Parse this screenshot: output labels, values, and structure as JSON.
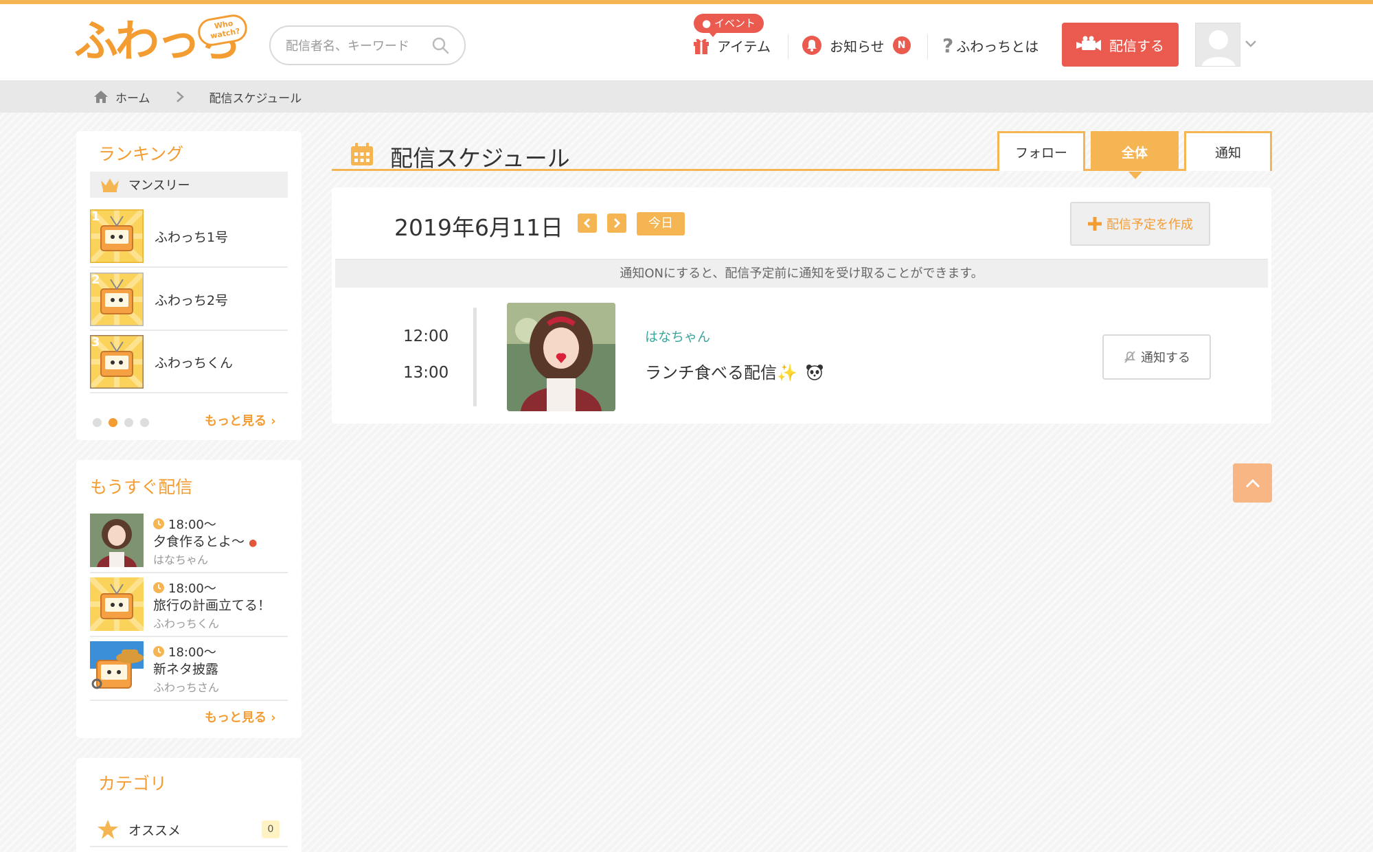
{
  "header": {
    "logo_text": "ふわっち",
    "logo_bubble": "Who watch?",
    "search_placeholder": "配信者名、キーワード",
    "event_label": "イベント",
    "nav": {
      "items_label": "アイテム",
      "news_label": "お知らせ",
      "news_badge": "N",
      "about_label": "ふわっちとは"
    },
    "broadcast_label": "配信する"
  },
  "breadcrumb": {
    "home": "ホーム",
    "current": "配信スケジュール"
  },
  "sidebar": {
    "ranking": {
      "title": "ランキング",
      "period": "マンスリー",
      "items": [
        {
          "rank": "1",
          "name": "ふわっち1号"
        },
        {
          "rank": "2",
          "name": "ふわっち2号"
        },
        {
          "rank": "3",
          "name": "ふわっちくん"
        }
      ],
      "more": "もっと見る"
    },
    "upcoming": {
      "title": "もうすぐ配信",
      "items": [
        {
          "time": "18:00〜",
          "title": "夕食作るとよ〜",
          "user": "はなちゃん"
        },
        {
          "time": "18:00〜",
          "title": "旅行の計画立てる！",
          "user": "ふわっちくん"
        },
        {
          "time": "18:00〜",
          "title": "新ネタ披露",
          "user": "ふわっちさん"
        }
      ],
      "more": "もっと見る"
    },
    "category": {
      "title": "カテゴリ",
      "items": [
        {
          "name": "オススメ",
          "count": "0"
        }
      ]
    }
  },
  "main": {
    "title": "配信スケジュール",
    "tabs": [
      "フォロー",
      "全体",
      "通知"
    ],
    "active_tab": "全体",
    "date": "2019年6月11日",
    "today_label": "今日",
    "create_label": "配信予定を作成",
    "notice": "通知ONにすると、配信予定前に通知を受け取ることができます。",
    "schedule": [
      {
        "start": "12:00",
        "end": "13:00",
        "user": "はなちゃん",
        "title": "ランチ食べる配信✨",
        "notify_label": "通知する"
      }
    ]
  },
  "colors": {
    "accent": "#f5b552",
    "brand_orange": "#f39c32",
    "red": "#ea5a4f",
    "teal": "#3aa59a"
  }
}
